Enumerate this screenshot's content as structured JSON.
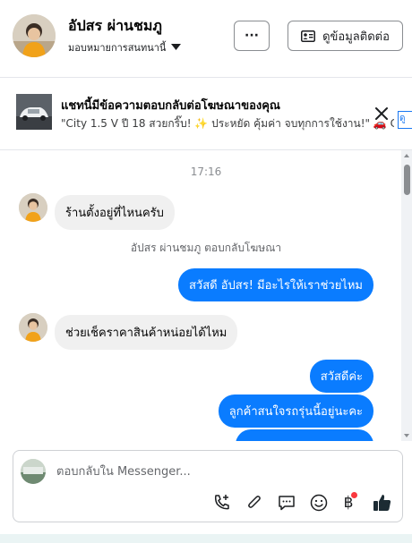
{
  "header": {
    "contact_name": "อัปสร ผ่านชมภู",
    "assignment_label": "มอบหมายการสนทนานี้",
    "more_label": "···",
    "contact_button_label": "ดูข้อมูลติดต่อ"
  },
  "ad_banner": {
    "title": "แชทนี้มีข้อความตอบกลับต่อโฆษณาของคุณ",
    "text": "\"City 1.5 V ปี 18 สวยกริ๊บ! ✨ ประหยัด คุ้มค่า จบทุกการใช้งาน!\" 🚗 City ...",
    "edge_label": "ดู"
  },
  "thread": {
    "timestamp": "17:16",
    "messages": [
      {
        "text": "ร้านตั้งอยู่ที่ไหนครับ"
      },
      {
        "text": "สวัสดี อัปสร! มีอะไรให้เราช่วยไหม"
      },
      {
        "text": "ช่วยเช็คราคาสินค้าหน่อยได้ไหม"
      },
      {
        "text": "สวัสดีค่ะ"
      },
      {
        "text": "ลูกค้าสนใจรถรุ่นนี้อยู่นะคะ"
      }
    ],
    "ad_reply_note": "อัปสร ผ่านชมภู ตอบกลับโฆษณา"
  },
  "composer": {
    "placeholder": "ตอบกลับใน Messenger..."
  },
  "icons": [
    "chevron-down-icon",
    "contact-card-icon",
    "close-icon",
    "call-add-icon",
    "attachment-icon",
    "saved-reply-icon",
    "emoji-icon",
    "baht-icon",
    "thumbs-up-icon"
  ],
  "colors": {
    "accent": "#0a7cff",
    "incoming_bubble": "#f0f0f0",
    "notification": "#fa383e",
    "thumbs_up": "#1c2b33"
  }
}
